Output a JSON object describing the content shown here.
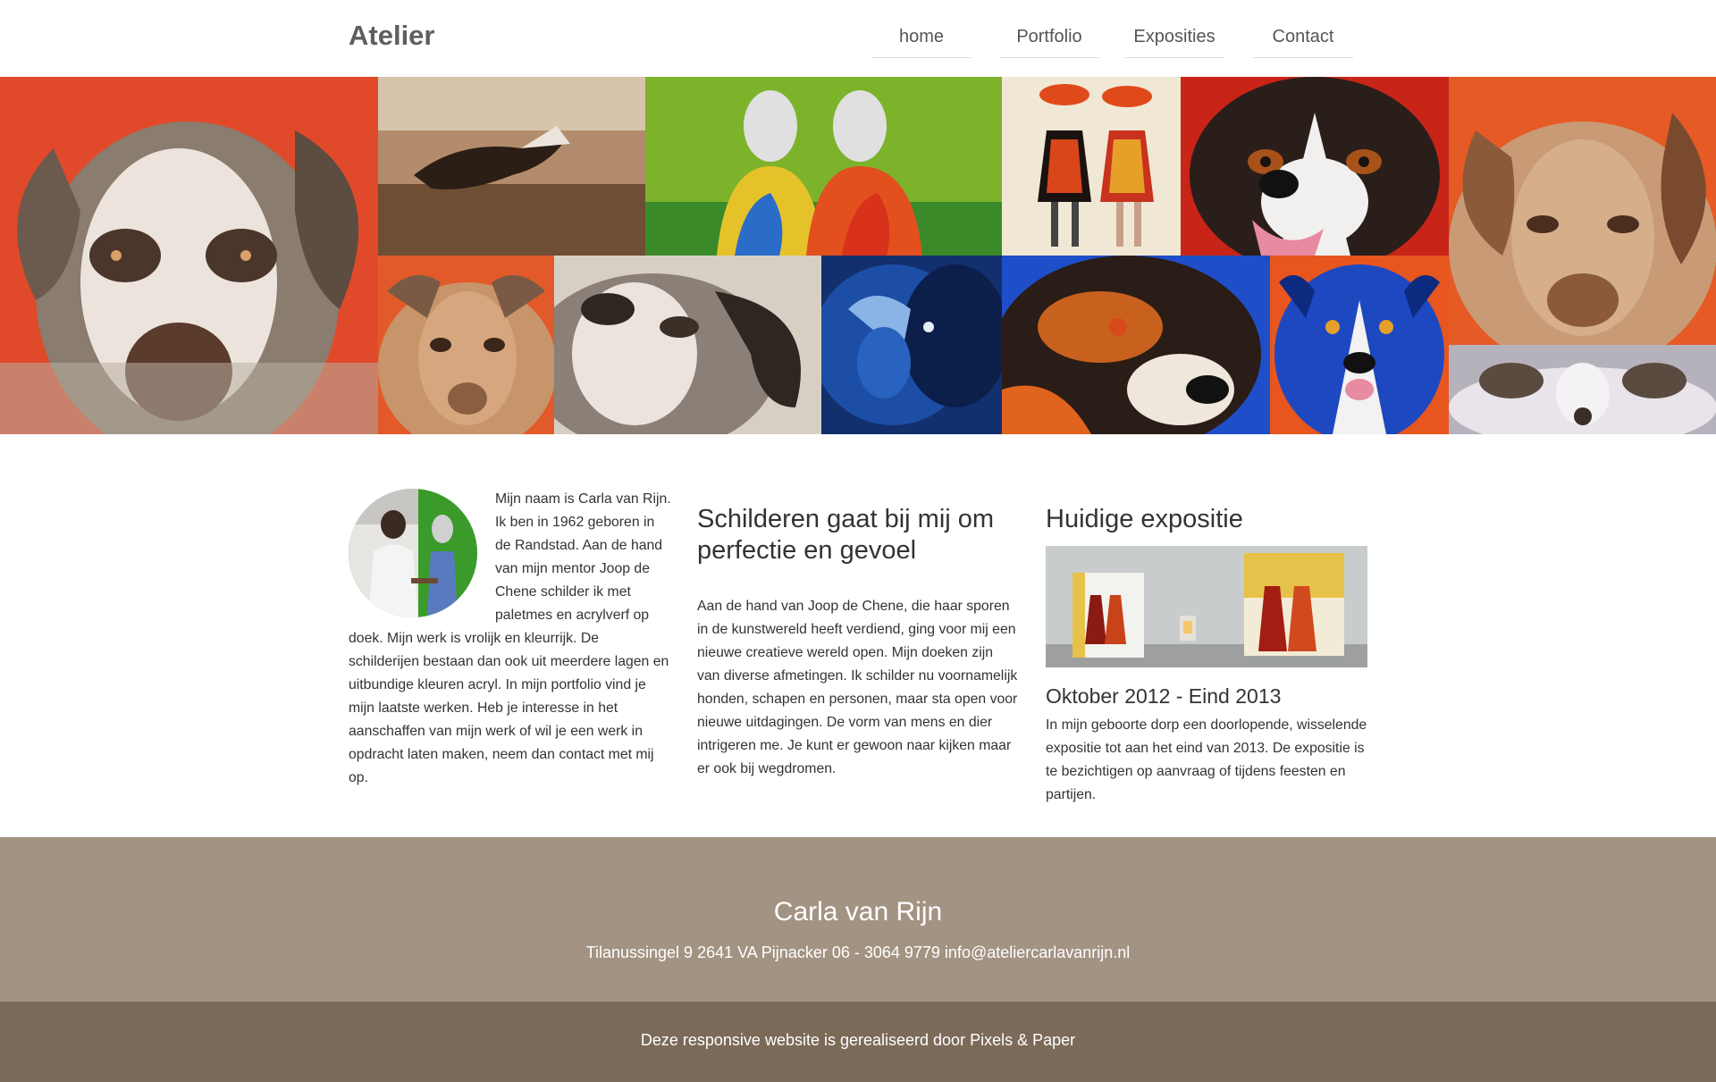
{
  "header": {
    "logo": "Atelier",
    "nav": [
      "home",
      "Portfolio",
      "Exposities",
      "Contact"
    ]
  },
  "banner": {
    "tiles": [
      "ram-painting-red",
      "running-dog-painting",
      "two-women-painting-green",
      "fashion-ladies-painting",
      "border-collie-painting-red",
      "ram-painting-orange",
      "sheep-painting-brown",
      "sheep-painting-grey",
      "sheep-painting-blue",
      "dog-painting-blue",
      "blue-dog-painting",
      "sheep-painting-white"
    ]
  },
  "about": {
    "text": "Mijn naam is Carla van Rijn. Ik ben in 1962 geboren in de Randstad. Aan de hand van mijn mentor Joop de Chene schilder ik met paletmes en acrylverf op doek. Mijn werk is vrolijk en kleurrijk. De schilderijen bestaan dan ook uit meerdere lagen en uitbundige kleuren acryl. In mijn portfolio vind je mijn laatste werken. Heb je interesse in het aanschaffen van mijn werk of wil je een werk in opdracht laten maken, neem dan contact met mij op."
  },
  "passion": {
    "title": "Schilderen gaat bij mij om perfectie en gevoel",
    "text": "Aan de hand van Joop de Chene, die haar sporen in de kunstwereld heeft verdiend, ging voor mij een nieuwe creatieve wereld open. Mijn doeken zijn van diverse afmetingen. Ik schilder nu voornamelijk honden, schapen en personen, maar sta open voor nieuwe uitdagingen. De vorm van mens en dier intrigeren me. Je kunt er gewoon naar kijken maar er ook bij wegdromen."
  },
  "exhibition": {
    "title": "Huidige expositie",
    "period": "Oktober 2012 - Eind 2013",
    "text": "In mijn geboorte dorp een doorlopende, wisselende expositie tot aan het eind van 2013. De expositie is te bezichtigen op aanvraag of tijdens feesten en partijen."
  },
  "footer": {
    "name": "Carla van Rijn",
    "contact": "Tilanussingel 9 2641 VA Pijnacker 06 - 3064 9779 info@ateliercarlavanrijn.nl",
    "credit": "Deze responsive website is gerealiseerd door Pixels & Paper"
  },
  "colors": {
    "footer_top": "#a39383",
    "footer_bottom": "#7c6a59",
    "text": "#333333"
  }
}
